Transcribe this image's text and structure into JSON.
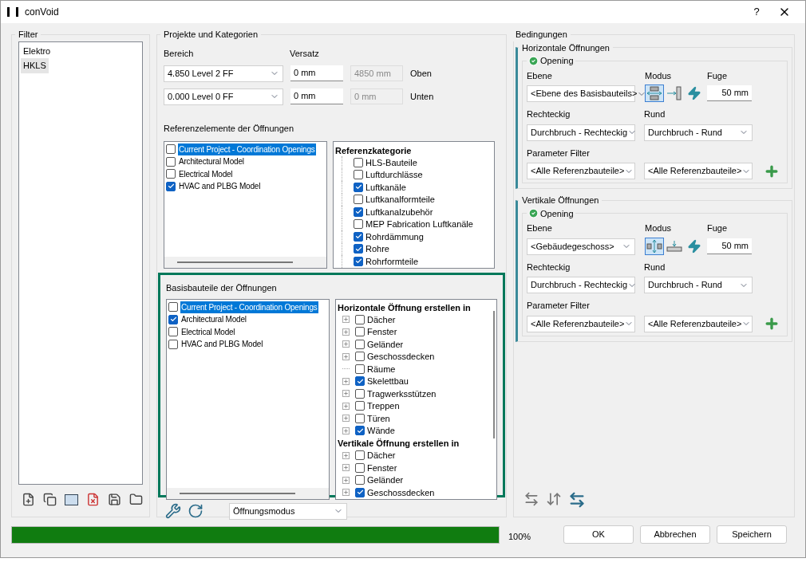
{
  "window": {
    "title": "conVoid",
    "help": "?"
  },
  "filter": {
    "title": "Filter",
    "items": [
      {
        "label": "Elektro",
        "selected": false
      },
      {
        "label": "HKLS",
        "selected": true
      }
    ]
  },
  "projects": {
    "title": "Projekte und Kategorien",
    "range_label": "Bereich",
    "offset_label": "Versatz",
    "ranges": [
      {
        "level": "4.850  Level 2 FF",
        "offset": "0 mm",
        "absolute": "4850 mm",
        "side": "Oben"
      },
      {
        "level": "0.000  Level 0 FF",
        "offset": "0 mm",
        "absolute": "0 mm",
        "side": "Unten"
      }
    ],
    "reference": {
      "title": "Referenzelemente der Öffnungen",
      "models": [
        {
          "label": "Current Project - Coordination Openings",
          "checked": false,
          "selected": true
        },
        {
          "label": "Architectural Model",
          "checked": false,
          "selected": false
        },
        {
          "label": "Electrical Model",
          "checked": false,
          "selected": false
        },
        {
          "label": "HVAC and PLBG Model",
          "checked": true,
          "selected": false
        }
      ],
      "category_heading": "Referenzkategorie",
      "categories": [
        {
          "label": "HLS-Bauteile",
          "checked": false
        },
        {
          "label": "Luftdurchlässe",
          "checked": false
        },
        {
          "label": "Luftkanäle",
          "checked": true
        },
        {
          "label": "Luftkanalformteile",
          "checked": false
        },
        {
          "label": "Luftkanalzubehör",
          "checked": true
        },
        {
          "label": "MEP Fabrication Luftkanäle",
          "checked": false
        },
        {
          "label": "Rohrdämmung",
          "checked": true
        },
        {
          "label": "Rohre",
          "checked": true
        },
        {
          "label": "Rohrformteile",
          "checked": true
        }
      ]
    },
    "base": {
      "title": "Basisbauteile der Öffnungen",
      "focused": true,
      "models": [
        {
          "label": "Current Project - Coordination Openings",
          "checked": false,
          "selected": true
        },
        {
          "label": "Architectural Model",
          "checked": true,
          "selected": false
        },
        {
          "label": "Electrical Model",
          "checked": false,
          "selected": false
        },
        {
          "label": "HVAC and PLBG Model",
          "checked": false,
          "selected": false
        }
      ],
      "groups": [
        {
          "heading": "Horizontale Öffnung erstellen in",
          "children": [
            {
              "label": "Dächer",
              "checked": false,
              "expandable": true
            },
            {
              "label": "Fenster",
              "checked": false,
              "expandable": true
            },
            {
              "label": "Geländer",
              "checked": false,
              "expandable": true
            },
            {
              "label": "Geschossdecken",
              "checked": false,
              "expandable": true
            },
            {
              "label": "Räume",
              "checked": false,
              "expandable": false
            },
            {
              "label": "Skelettbau",
              "checked": true,
              "expandable": true
            },
            {
              "label": "Tragwerksstützen",
              "checked": false,
              "expandable": true
            },
            {
              "label": "Treppen",
              "checked": false,
              "expandable": true
            },
            {
              "label": "Türen",
              "checked": false,
              "expandable": true
            },
            {
              "label": "Wände",
              "checked": true,
              "expandable": true
            }
          ]
        },
        {
          "heading": "Vertikale Öffnung erstellen in",
          "children": [
            {
              "label": "Dächer",
              "checked": false,
              "expandable": true
            },
            {
              "label": "Fenster",
              "checked": false,
              "expandable": true
            },
            {
              "label": "Geländer",
              "checked": false,
              "expandable": true
            },
            {
              "label": "Geschossdecken",
              "checked": true,
              "expandable": true
            }
          ]
        }
      ]
    },
    "mode_select": "Öffnungsmodus"
  },
  "conditions": {
    "title": "Bedingungen",
    "sections": [
      {
        "title": "Horizontale Öffnungen",
        "opening": "Opening",
        "level_label": "Ebene",
        "level": "<Ebene des Basisbauteils>",
        "mode_label": "Modus",
        "modes": [
          {
            "kind": "through",
            "selected": true
          },
          {
            "kind": "side",
            "selected": false
          },
          {
            "kind": "bolt",
            "selected": false
          }
        ],
        "gap_label": "Fuge",
        "gap": "50 mm",
        "rect_label": "Rechteckig",
        "rect": "Durchbruch - Rechteckig",
        "round_label": "Rund",
        "round": "Durchbruch - Rund",
        "filter_label": "Parameter Filter",
        "filters": [
          "<Alle Referenzbauteile>",
          "<Alle Referenzbauteile>"
        ]
      },
      {
        "title": "Vertikale Öffnungen",
        "opening": "Opening",
        "level_label": "Ebene",
        "level": "<Gebäudegeschoss>",
        "mode_label": "Modus",
        "modes": [
          {
            "kind": "vertical",
            "selected": true
          },
          {
            "kind": "floor",
            "selected": false
          },
          {
            "kind": "bolt",
            "selected": false
          }
        ],
        "gap_label": "Fuge",
        "gap": "50 mm",
        "rect_label": "Rechteckig",
        "rect": "Durchbruch - Rechteckig",
        "round_label": "Rund",
        "round": "Durchbruch - Rund",
        "filter_label": "Parameter Filter",
        "filters": [
          "<Alle Referenzbauteile>",
          "<Alle Referenzbauteile>"
        ]
      }
    ]
  },
  "progress": {
    "level": 1,
    "reading": "100%"
  },
  "buttons": [
    "OK",
    "Abbrechen",
    "Speichern"
  ]
}
